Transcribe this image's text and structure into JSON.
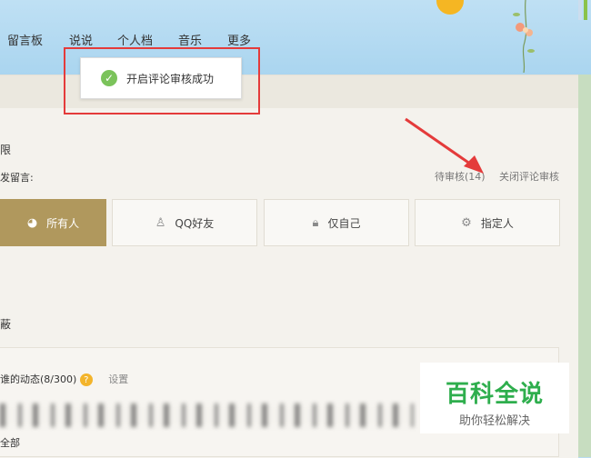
{
  "nav": {
    "items": [
      "留言板",
      "说说",
      "个人档",
      "音乐",
      "更多"
    ]
  },
  "toast": {
    "message": "开启评论审核成功"
  },
  "permission": {
    "section_title": "限",
    "prompt": "发留言:",
    "pending_label": "待审核(14)",
    "close_review_label": "关闭评论审核",
    "options": [
      {
        "label": "所有人",
        "icon": "globe-icon",
        "active": true
      },
      {
        "label": "QQ好友",
        "icon": "friends-icon",
        "active": false
      },
      {
        "label": "仅自己",
        "icon": "lock-icon",
        "active": false
      },
      {
        "label": "指定人",
        "icon": "gear-icon",
        "active": false
      }
    ]
  },
  "feed": {
    "section_title": "蔽",
    "label": "谁的动态(8/300)",
    "help": "?",
    "settings_label": "设置",
    "all_label": "全部"
  },
  "watermark": {
    "main": "百科全说",
    "sub": "助你轻松解决"
  },
  "colors": {
    "active_option": "#b0985d",
    "toast_frame": "#e43b3b",
    "success": "#7bc35b",
    "watermark_green": "#2eae4d"
  }
}
